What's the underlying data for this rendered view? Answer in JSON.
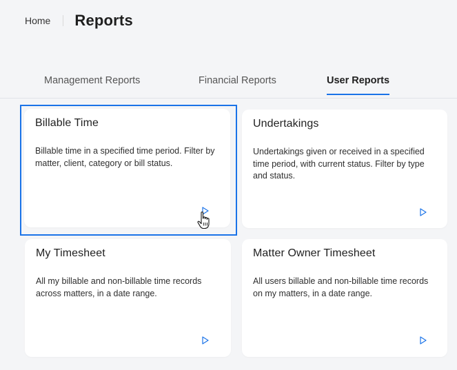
{
  "breadcrumb": {
    "home_label": "Home"
  },
  "page": {
    "title": "Reports"
  },
  "tabs": [
    {
      "label": "Management Reports",
      "active": false
    },
    {
      "label": "Financial Reports",
      "active": false
    },
    {
      "label": "User Reports",
      "active": true
    }
  ],
  "cards": [
    {
      "title": "Billable Time",
      "description": "Billable time in a specified time period. Filter by matter, client, category or bill status.",
      "icon": "play-arrow-icon",
      "focused": true
    },
    {
      "title": "Undertakings",
      "description": "Undertakings given or received in a specified time period, with current status. Filter by type and status.",
      "icon": "play-arrow-icon"
    },
    {
      "title": "My Timesheet",
      "description": "All my billable and non-billable time records across matters, in a date range.",
      "icon": "play-arrow-icon"
    },
    {
      "title": "Matter Owner Timesheet",
      "description": "All users billable and non-billable time records on my matters, in a date range.",
      "icon": "play-arrow-icon"
    }
  ],
  "colors": {
    "accent": "#1a73e8",
    "background": "#f4f5f7",
    "card": "#ffffff"
  }
}
